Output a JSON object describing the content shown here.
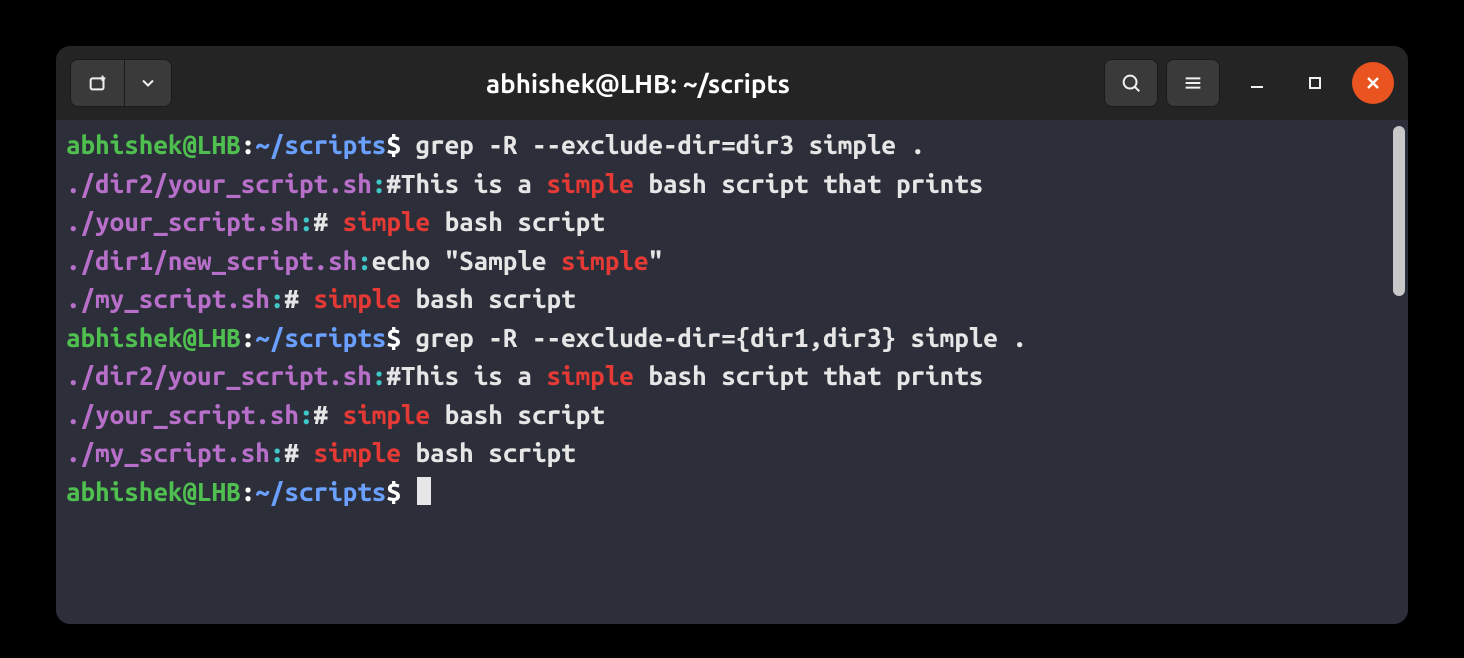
{
  "window": {
    "title": "abhishek@LHB: ~/scripts"
  },
  "prompt": {
    "user_host": "abhishek@LHB",
    "colon": ":",
    "path": "~/scripts",
    "symbol": "$"
  },
  "commands": {
    "cmd1": "grep -R --exclude-dir=dir3 simple .",
    "cmd2": "grep -R --exclude-dir={dir1,dir3} simple ."
  },
  "output1": [
    {
      "file": "./dir2/your_script.sh",
      "pre": "#This is a ",
      "match": "simple",
      "post": " bash script that prints"
    },
    {
      "file": "./your_script.sh",
      "pre": "# ",
      "match": "simple",
      "post": " bash script"
    },
    {
      "file": "./dir1/new_script.sh",
      "pre": "echo \"Sample ",
      "match": "simple",
      "post": "\""
    },
    {
      "file": "./my_script.sh",
      "pre": "# ",
      "match": "simple",
      "post": " bash script"
    }
  ],
  "output2": [
    {
      "file": "./dir2/your_script.sh",
      "pre": "#This is a ",
      "match": "simple",
      "post": " bash script that prints"
    },
    {
      "file": "./your_script.sh",
      "pre": "# ",
      "match": "simple",
      "post": " bash script"
    },
    {
      "file": "./my_script.sh",
      "pre": "# ",
      "match": "simple",
      "post": " bash script"
    }
  ]
}
